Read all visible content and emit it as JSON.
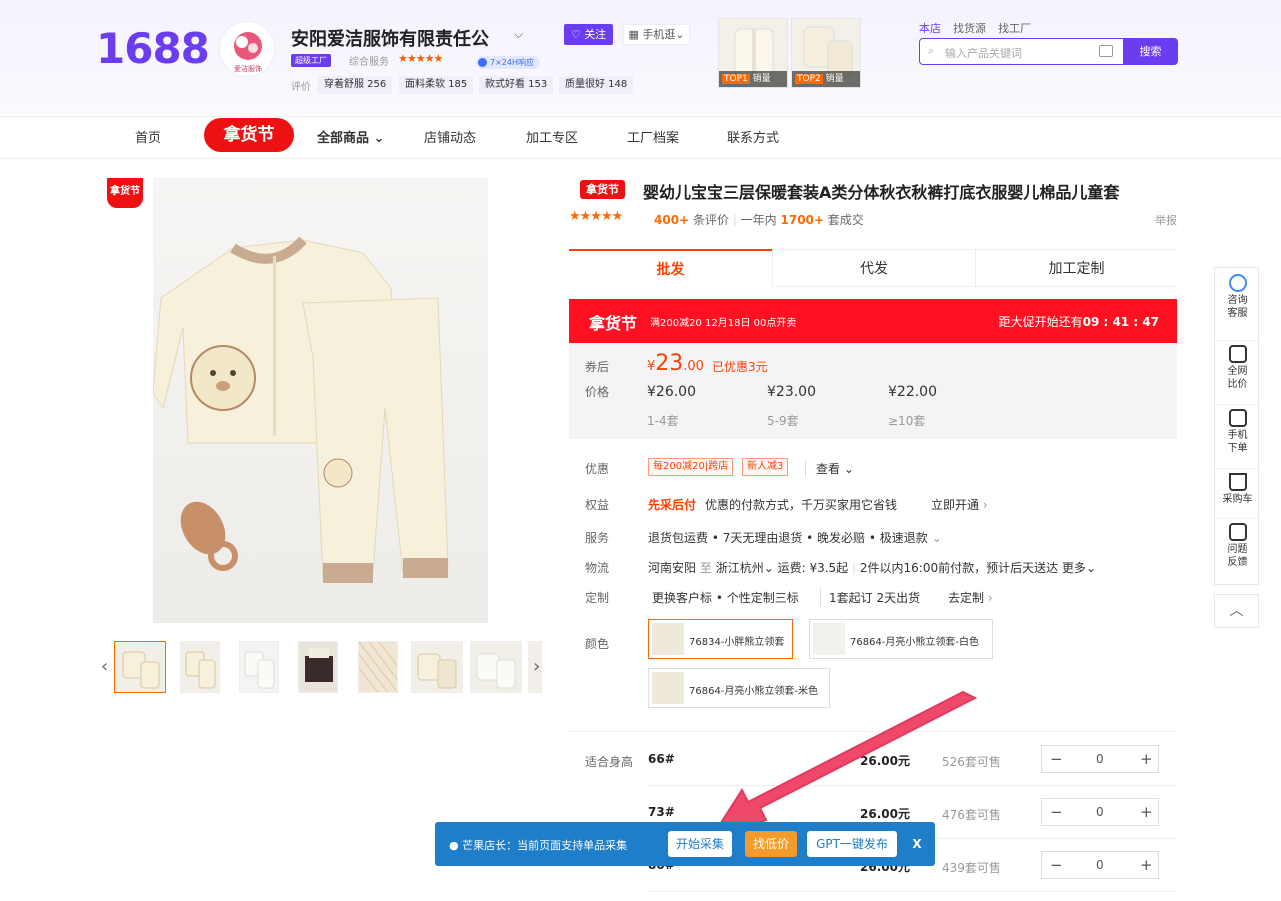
{
  "header": {
    "logo": "1688",
    "shop_name": "安阳爱洁服饰有限责任公",
    "follow_label": "关注",
    "mobile_label": "手机逛",
    "factory_badge": "超级工厂",
    "service_label": "综合服务",
    "service_stars": "★★★★★",
    "service_tag": "7×24H响应",
    "rating_label": "评价",
    "ratings": [
      "穿着舒服 256",
      "面料柔软 185",
      "款式好看 153",
      "质量很好 148"
    ],
    "top_items": [
      {
        "rank": "TOP1",
        "label": "销量"
      },
      {
        "rank": "TOP2",
        "label": "销量"
      }
    ],
    "links": [
      "本店",
      "找货源",
      "找工厂"
    ],
    "search_placeholder": "输入产品关键词",
    "search_button": "搜索"
  },
  "nav": {
    "items": [
      "首页",
      "拿货节",
      "全部商品",
      "店铺动态",
      "加工专区",
      "工厂档案",
      "联系方式"
    ]
  },
  "gallery": {
    "badge": "拿货节",
    "logo_text": "爱洁服饰"
  },
  "product": {
    "tag": "拿货节",
    "title": "婴幼儿宝宝三层保暖套装A类分体秋衣秋裤打底衣服婴儿棉品儿童套",
    "stars": "★★★★★",
    "reviews_count": "400+",
    "reviews_label": "条评价",
    "year_label": "一年内",
    "sold_count": "1700+",
    "sold_label": "套成交",
    "report": "举报",
    "tabs": [
      "批发",
      "代发",
      "加工定制"
    ],
    "promo": {
      "title": "拿货节",
      "desc": "满200减20 12月18日 00点开卖",
      "countdown_label": "距大促开始还有",
      "countdown": "09 : 41 : 47"
    },
    "price": {
      "coupon_label_1": "券后",
      "coupon_label_2": "价格",
      "coupon_price_symbol": "¥",
      "coupon_price_int": "23",
      "coupon_price_dec": ".00",
      "coupon_saved": "已优惠3元",
      "tiers": [
        {
          "price": "¥26.00",
          "qty": "1-4套"
        },
        {
          "price": "¥23.00",
          "qty": "5-9套"
        },
        {
          "price": "¥22.00",
          "qty": "≥10套"
        }
      ]
    },
    "discount_label": "优惠",
    "coupons": [
      "每200减20|跨店",
      "新人减3"
    ],
    "view_label": "查看",
    "rights_label": "权益",
    "rights_highlight": "先采后付",
    "rights_desc": "优惠的付款方式，千万买家用它省钱",
    "rights_action": "立即开通",
    "service_label": "服务",
    "service_desc": "退货包运费 • 7天无理由退货 • 晚发必赔 • 极速退款",
    "logistics_label": "物流",
    "logistics_from": "河南安阳",
    "logistics_to_word": "至",
    "logistics_to": "浙江杭州",
    "logistics_fee": "运费: ¥3.5起",
    "logistics_desc": "2件以内16:00前付款，预计后天送达",
    "logistics_more": "更多",
    "custom_label": "定制",
    "custom_desc": "更换客户标 • 个性定制三标",
    "custom_moq": "1套起订",
    "custom_days": "2天出货",
    "custom_action": "去定制",
    "color_label": "颜色",
    "colors": [
      "76834-小胖熊立领套",
      "76864-月亮小熊立领套-白色",
      "76864-月亮小熊立领套-米色"
    ],
    "size_label": "适合身高",
    "sizes": [
      {
        "size": "66#",
        "price": "26.00元",
        "stock": "526套可售",
        "qty": "0"
      },
      {
        "size": "73#",
        "price": "26.00元",
        "stock": "476套可售",
        "qty": "0"
      },
      {
        "size": "80#",
        "price": "26.00元",
        "stock": "439套可售",
        "qty": "0"
      }
    ]
  },
  "sidebar": {
    "items": [
      "咨询客服",
      "全网比价",
      "手机下单",
      "采购车",
      "问题反馈"
    ]
  },
  "plugin": {
    "text": "芒果店长：当前页面支持单品采集",
    "btn_collect": "开始采集",
    "btn_lowprice": "找低价",
    "btn_gpt": "GPT一键发布",
    "close": "X"
  },
  "colors": {
    "brand": "#6a3df0",
    "accent": "#ff4000",
    "promo_red": "#ee1111",
    "plugin_blue": "#1f7ec9",
    "arrow_pink": "#f0486b"
  }
}
